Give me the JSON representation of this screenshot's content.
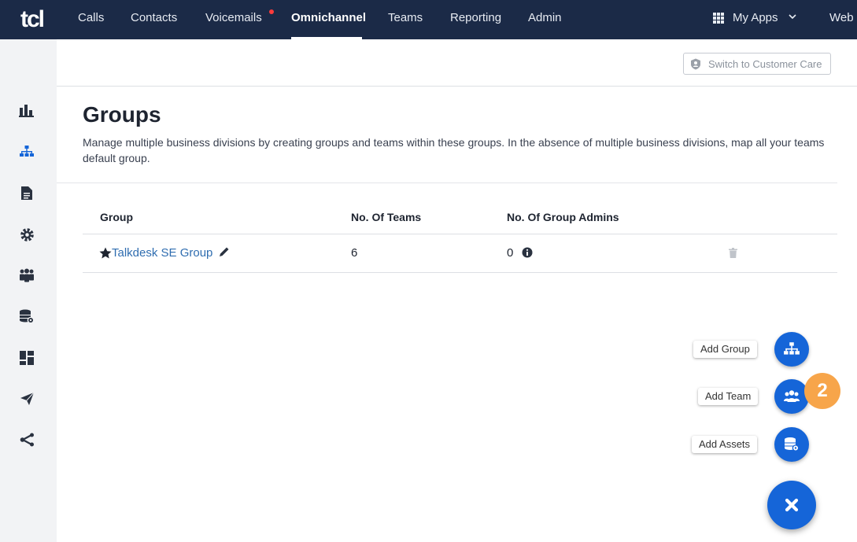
{
  "app": {
    "logo": "tcl"
  },
  "nav": {
    "items": [
      {
        "label": "Calls",
        "active": false,
        "has_notification": false
      },
      {
        "label": "Contacts",
        "active": false,
        "has_notification": false
      },
      {
        "label": "Voicemails",
        "active": false,
        "has_notification": true
      },
      {
        "label": "Omnichannel",
        "active": true,
        "has_notification": false
      },
      {
        "label": "Teams",
        "active": false,
        "has_notification": false
      },
      {
        "label": "Reporting",
        "active": false,
        "has_notification": false
      },
      {
        "label": "Admin",
        "active": false,
        "has_notification": false
      }
    ],
    "my_apps": "My Apps",
    "web": "Web"
  },
  "sidebar": {
    "icons": [
      "bar-chart-icon",
      "org-chart-icon",
      "document-icon",
      "gear-icon",
      "people-icon",
      "database-settings-icon",
      "dashboard-icon",
      "paper-plane-icon",
      "share-icon"
    ],
    "active_index": 1
  },
  "header": {
    "switch_button": "Switch to Customer Care"
  },
  "page": {
    "title": "Groups",
    "description_line1": "Manage multiple business divisions by creating groups and teams within these groups. In the absence of multiple business divisions, map all your teams",
    "description_line2": "default group."
  },
  "table": {
    "columns": [
      "Group",
      "No. Of Teams",
      "No. Of Group Admins"
    ],
    "rows": [
      {
        "group": "Talkdesk SE Group",
        "teams": "6",
        "admins": "0"
      }
    ]
  },
  "fab": {
    "add_group": "Add Group",
    "add_team": "Add Team",
    "add_assets": "Add Assets",
    "step_badge": "2"
  },
  "colors": {
    "topbar": "#1b2a47",
    "accent": "#1565d8",
    "link": "#2f6db0",
    "badge": "#f7a54a"
  }
}
